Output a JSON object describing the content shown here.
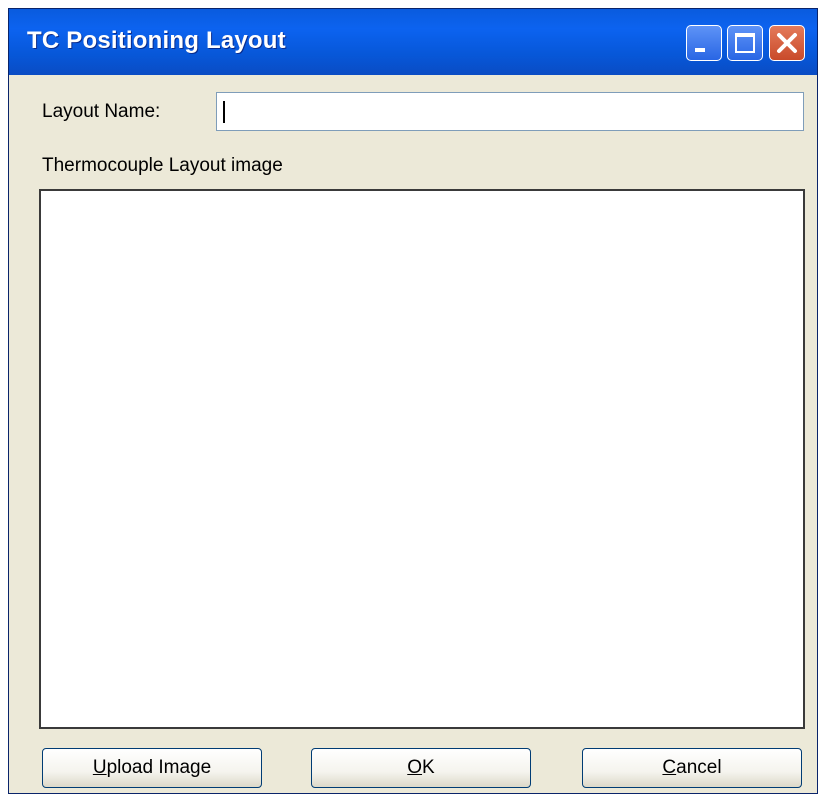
{
  "window": {
    "title": "TC Positioning Layout"
  },
  "form": {
    "layout_name_label": "Layout Name:",
    "layout_name_value": "",
    "image_label": "Thermocouple Layout image"
  },
  "buttons": {
    "upload": {
      "mnemonic": "U",
      "rest": "pload Image"
    },
    "ok": {
      "mnemonic": "O",
      "rest": "K"
    },
    "cancel": {
      "mnemonic": "C",
      "rest": "ancel"
    }
  },
  "icons": {
    "minimize": "minimize-icon",
    "maximize": "maximize-icon",
    "close": "close-icon"
  },
  "colors": {
    "titlebar": "#0c63f0",
    "dialog_bg": "#ece9d8",
    "close_button": "#c94a2a"
  }
}
